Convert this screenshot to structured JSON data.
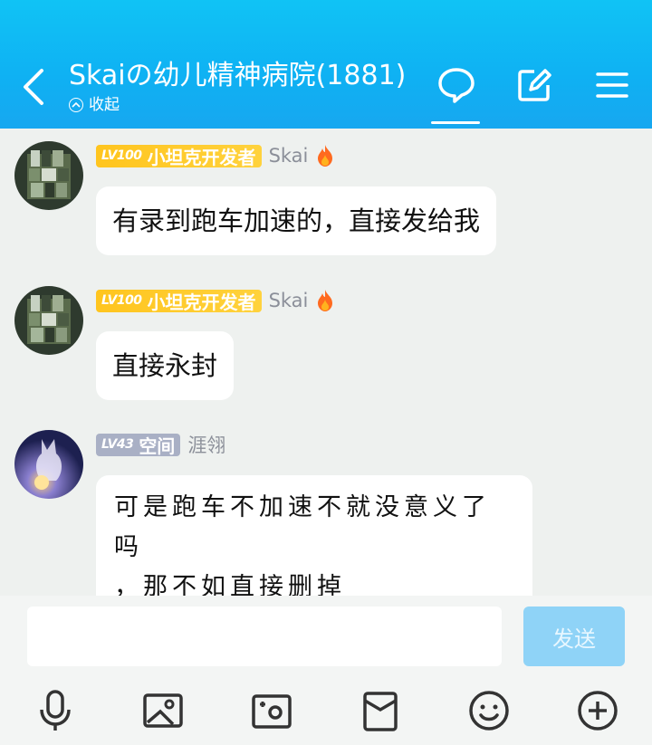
{
  "header": {
    "title": "Skaiの幼儿精神病院(1881)",
    "collapse_label": "收起",
    "icons": [
      "back-icon",
      "chat-bubble-icon",
      "edit-icon",
      "menu-icon"
    ]
  },
  "messages": [
    {
      "level": "LV100",
      "title_tag": "小坦克开发者",
      "nickname": "Skai",
      "text": "有录到跑车加速的，直接发给我",
      "badge_color": "#ffc51e"
    },
    {
      "level": "LV100",
      "title_tag": "小坦克开发者",
      "nickname": "Skai",
      "text": "直接永封",
      "badge_color": "#ffc51e"
    },
    {
      "level": "LV43",
      "title_tag": "空间",
      "nickname": "涯翎",
      "text_line1": "可是跑车不加速不就没意义了吗",
      "text_line2": "，那不如直接删掉",
      "badge_color": "#a9b0c5"
    }
  ],
  "composer": {
    "input_value": "",
    "send_label": "发送"
  },
  "bottom_icons": [
    "microphone-icon",
    "image-icon",
    "camera-icon",
    "red-packet-icon",
    "emoji-icon",
    "plus-icon"
  ],
  "colors": {
    "header": "#10c3f5",
    "send_disabled": "#8fd3f7",
    "background": "#eef1ef"
  }
}
